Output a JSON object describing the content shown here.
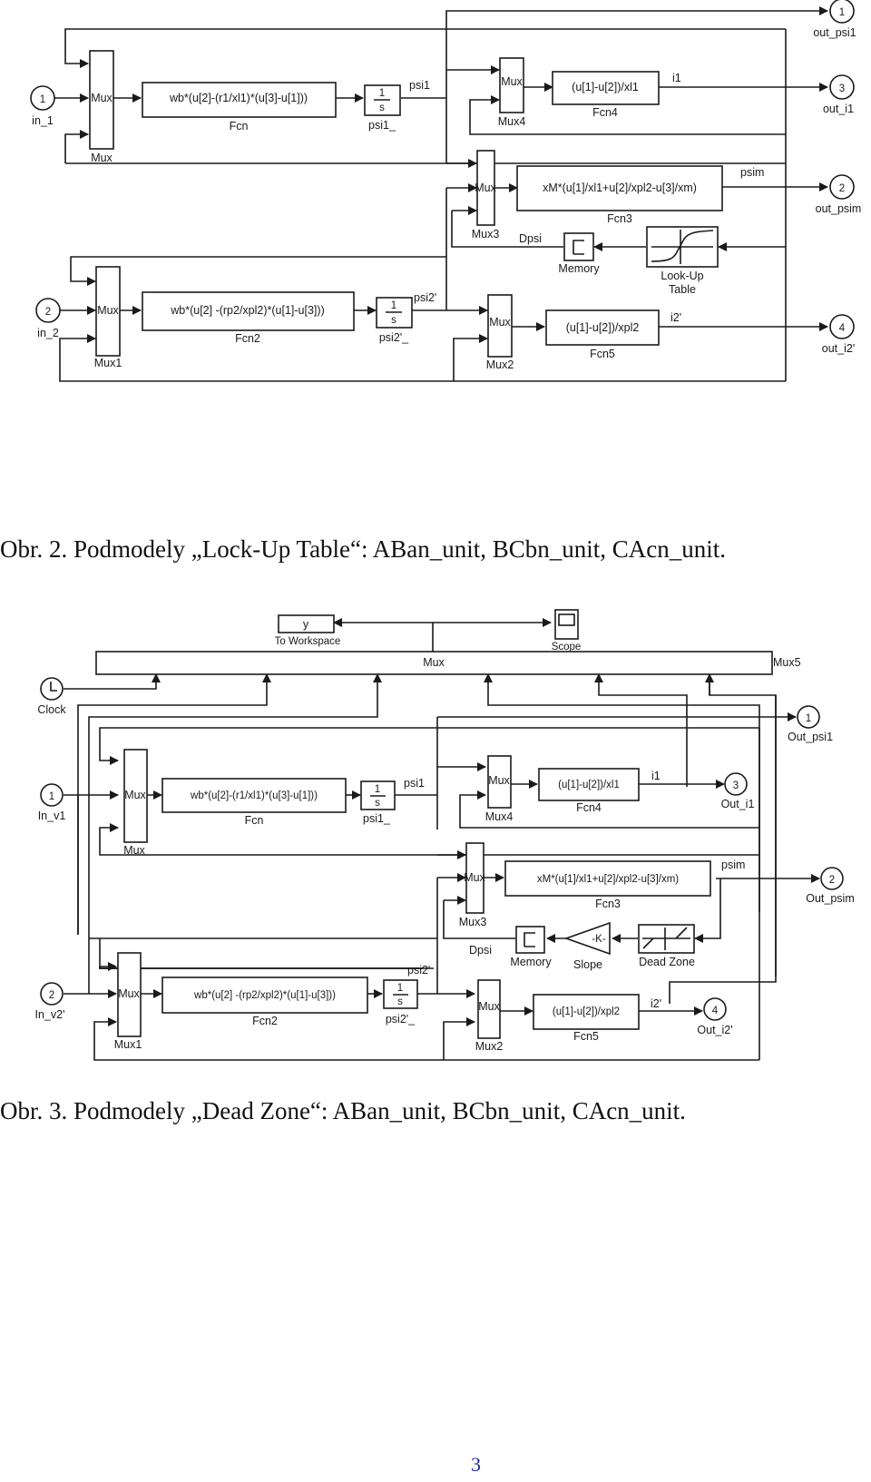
{
  "figure2": {
    "caption": "Obr. 2.  Podmodely „Lock-Up Table“: ABan_unit, BCbn_unit, CAcn_unit.",
    "inports": [
      {
        "num": "1",
        "name": "in_1"
      },
      {
        "num": "2",
        "name": "in_2"
      }
    ],
    "outports": [
      {
        "num": "1",
        "name": "out_psi1"
      },
      {
        "num": "3",
        "name": "out_i1"
      },
      {
        "num": "2",
        "name": "out_psim"
      },
      {
        "num": "4",
        "name": "out_i2'"
      }
    ],
    "mux_label": "Mux",
    "mux_names": {
      "mux": "Mux",
      "mux1": "Mux1",
      "mux2": "Mux2",
      "mux3": "Mux3",
      "mux4": "Mux4"
    },
    "fcn": {
      "expr": "wb*(u[2]-(r1/xl1)*(u[3]-u[1]))",
      "name": "Fcn"
    },
    "fcn2": {
      "expr": "wb*(u[2] -(rp2/xpl2)*(u[1]-u[3]))",
      "name": "Fcn2"
    },
    "fcn3": {
      "expr": "xM*(u[1]/xl1+u[2]/xpl2-u[3]/xm)",
      "name": "Fcn3"
    },
    "fcn4": {
      "expr": "(u[1]-u[2])/xl1",
      "name": "Fcn4"
    },
    "fcn5": {
      "expr": "(u[1]-u[2])/xpl2",
      "name": "Fcn5"
    },
    "integrator1": {
      "num": "1",
      "den": "s",
      "name": "psi1_"
    },
    "integrator2": {
      "num": "1",
      "den": "s",
      "name": "psi2'_"
    },
    "memory": {
      "name": "Memory"
    },
    "lookup": {
      "name_line1": "Look-Up",
      "name_line2": "Table"
    },
    "signals": {
      "psi1": "psi1",
      "psi2": "psi2'",
      "i1": "i1",
      "i2": "i2'",
      "psim": "psim",
      "dpsi": "Dpsi"
    }
  },
  "figure3": {
    "caption": "Obr. 3.  Podmodely „Dead Zone“: ABan_unit, BCbn_unit, CAcn_unit.",
    "inports": [
      {
        "num": "1",
        "name": "In_v1"
      },
      {
        "num": "2",
        "name": "In_v2'"
      }
    ],
    "outports": [
      {
        "num": "1",
        "name": "Out_psi1"
      },
      {
        "num": "3",
        "name": "Out_i1"
      },
      {
        "num": "2",
        "name": "Out_psim"
      },
      {
        "num": "4",
        "name": "Out_i2'"
      }
    ],
    "clock": {
      "name": "Clock"
    },
    "to_workspace": {
      "var": "y",
      "name": "To Workspace"
    },
    "scope": {
      "name": "Scope"
    },
    "mux5": {
      "label": "Mux",
      "name": "Mux5"
    },
    "mux_label": "Mux",
    "mux_names": {
      "mux": "Mux",
      "mux1": "Mux1",
      "mux2": "Mux2",
      "mux3": "Mux3",
      "mux4": "Mux4"
    },
    "fcn": {
      "expr": "wb*(u[2]-(r1/xl1)*(u[3]-u[1]))",
      "name": "Fcn"
    },
    "fcn2": {
      "expr": "wb*(u[2] -(rp2/xpl2)*(u[1]-u[3]))",
      "name": "Fcn2"
    },
    "fcn3": {
      "expr": "xM*(u[1]/xl1+u[2]/xpl2-u[3]/xm)",
      "name": "Fcn3"
    },
    "fcn4": {
      "expr": "(u[1]-u[2])/xl1",
      "name": "Fcn4"
    },
    "fcn5": {
      "expr": "(u[1]-u[2])/xpl2",
      "name": "Fcn5"
    },
    "integrator1": {
      "num": "1",
      "den": "s",
      "name": "psi1_"
    },
    "integrator2": {
      "num": "1",
      "den": "s",
      "name": "psi2'_"
    },
    "memory": {
      "name": "Memory"
    },
    "slope": {
      "gain": "-K-",
      "name": "Slope"
    },
    "dead_zone": {
      "name": "Dead Zone"
    },
    "signals": {
      "psi1": "psi1",
      "psi2": "psi2'",
      "i1": "i1",
      "i2": "i2'",
      "psim": "psim",
      "dpsi": "Dpsi"
    }
  },
  "page_number": "3"
}
